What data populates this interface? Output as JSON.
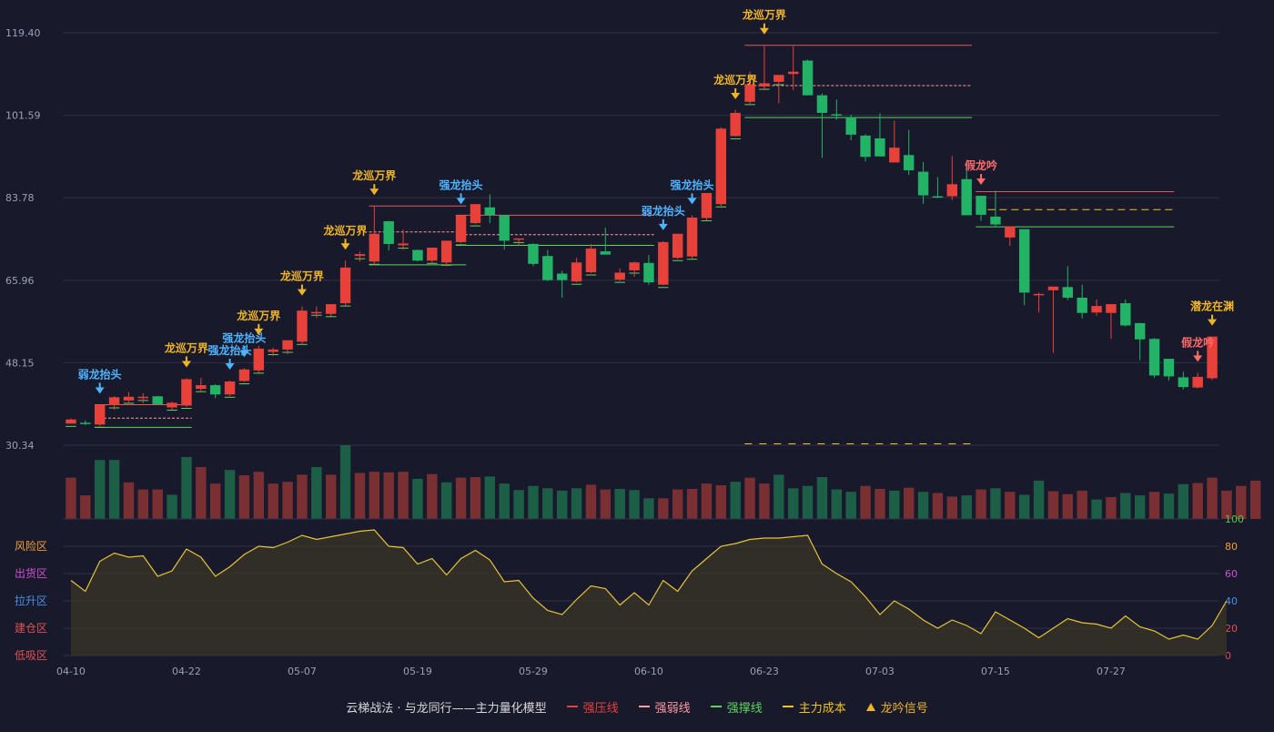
{
  "colors": {
    "up": "#e8413a",
    "down": "#23b366",
    "vol_up": "#7a2f33",
    "vol_down": "#1d5e47",
    "signal_gold": "#f0b429",
    "signal_blue": "#4fb3ff",
    "signal_pink": "#ff6b6b",
    "grid": "#2e3146",
    "axis_text": "#9aa0b4",
    "pressure_line": "#e05a5a",
    "support_line": "#5fd35f",
    "cost_line": "#f0c419",
    "osc_line": "#e8c23a"
  },
  "legend": {
    "title": "云梯战法 · 与龙同行——主力量化模型",
    "items": [
      {
        "label": "强压线",
        "color": "#e8413a",
        "style": "solid"
      },
      {
        "label": "强弱线",
        "color": "#ff9aa2",
        "style": "dashed"
      },
      {
        "label": "强撑线",
        "color": "#5fd35f",
        "style": "solid"
      },
      {
        "label": "主力成本",
        "color": "#f0c419",
        "style": "dashed"
      },
      {
        "label": "龙吟信号",
        "color": "#f0b429",
        "style": "triangle"
      }
    ]
  },
  "chart_data": [
    {
      "type": "candlestick",
      "title": "",
      "y_ticks": [
        "119.40",
        "101.59",
        "83.78",
        "65.96",
        "48.15",
        "30.34"
      ],
      "ylim": [
        30.34,
        119.4
      ],
      "x_tick_labels": [
        {
          "index": 0,
          "label": "04-10"
        },
        {
          "index": 8,
          "label": "04-22"
        },
        {
          "index": 16,
          "label": "05-07"
        },
        {
          "index": 24,
          "label": "05-19"
        },
        {
          "index": 32,
          "label": "05-29"
        },
        {
          "index": 40,
          "label": "06-10"
        },
        {
          "index": 48,
          "label": "06-23"
        },
        {
          "index": 56,
          "label": "07-03"
        },
        {
          "index": 64,
          "label": "07-15"
        },
        {
          "index": 72,
          "label": "07-27"
        }
      ],
      "candles": [
        [
          35.0,
          36.1,
          35.2,
          35.9
        ],
        [
          35.2,
          35.7,
          34.7,
          35.1
        ],
        [
          34.8,
          39.1,
          34.5,
          39.0
        ],
        [
          39.0,
          40.9,
          38.0,
          40.7
        ],
        [
          40.0,
          41.8,
          39.6,
          40.8
        ],
        [
          40.6,
          41.6,
          39.4,
          40.8
        ],
        [
          40.9,
          41.0,
          39.0,
          39.2
        ],
        [
          38.5,
          39.8,
          38.0,
          39.5
        ],
        [
          38.9,
          44.8,
          38.6,
          44.6
        ],
        [
          42.5,
          44.9,
          42.0,
          43.3
        ],
        [
          43.3,
          43.5,
          40.5,
          41.3
        ],
        [
          41.3,
          44.3,
          41.0,
          44.1
        ],
        [
          44.2,
          47.0,
          44.0,
          46.7
        ],
        [
          46.5,
          51.8,
          45.7,
          51.2
        ],
        [
          50.5,
          51.4,
          49.6,
          51.0
        ],
        [
          51.0,
          53.0,
          50.0,
          53.0
        ],
        [
          52.7,
          60.3,
          52.1,
          59.4
        ],
        [
          59.0,
          60.3,
          57.8,
          59.1
        ],
        [
          58.7,
          60.3,
          58.2,
          60.8
        ],
        [
          61.0,
          70.2,
          60.5,
          68.7
        ],
        [
          71.2,
          72.1,
          70.0,
          71.6
        ],
        [
          70.0,
          82.0,
          69.3,
          76.0
        ],
        [
          78.7,
          78.8,
          72.4,
          73.8
        ],
        [
          73.5,
          76.9,
          72.5,
          73.9
        ],
        [
          72.5,
          72.6,
          70.0,
          70.2
        ],
        [
          70.2,
          72.5,
          69.6,
          73.0
        ],
        [
          69.8,
          73.6,
          69.0,
          74.5
        ],
        [
          74.2,
          80.0,
          74.0,
          80.0
        ],
        [
          78.3,
          82.4,
          78.1,
          82.4
        ],
        [
          81.7,
          84.5,
          78.3,
          80.0
        ],
        [
          80.0,
          80.1,
          72.6,
          74.5
        ],
        [
          74.7,
          74.8,
          73.5,
          75.0
        ],
        [
          73.8,
          73.9,
          69.0,
          69.5
        ],
        [
          71.2,
          72.5,
          65.8,
          66.0
        ],
        [
          67.4,
          68.0,
          62.2,
          66.0
        ],
        [
          65.7,
          70.8,
          65.5,
          69.8
        ],
        [
          67.7,
          73.8,
          67.5,
          72.8
        ],
        [
          72.2,
          77.3,
          71.9,
          71.5
        ],
        [
          66.1,
          68.5,
          65.8,
          67.6
        ],
        [
          68.1,
          70.0,
          66.7,
          69.8
        ],
        [
          69.7,
          71.4,
          65.0,
          65.5
        ],
        [
          65.0,
          74.4,
          64.9,
          74.2
        ],
        [
          70.8,
          75.7,
          70.5,
          76.0
        ],
        [
          71.1,
          80.0,
          70.7,
          79.5
        ],
        [
          79.4,
          82.0,
          78.8,
          84.8
        ],
        [
          82.4,
          99.0,
          82.0,
          98.7
        ],
        [
          97.1,
          102.7,
          97.0,
          102.1
        ],
        [
          104.5,
          111.0,
          104.1,
          108.3
        ],
        [
          107.8,
          116.7,
          107.0,
          108.5
        ],
        [
          108.8,
          108.9,
          104.2,
          110.3
        ],
        [
          110.5,
          116.5,
          107.0,
          111.0
        ],
        [
          113.4,
          113.6,
          105.9,
          105.9
        ],
        [
          105.9,
          106.3,
          92.4,
          102.1
        ],
        [
          101.8,
          105.0,
          100.6,
          101.7
        ],
        [
          101.2,
          101.7,
          96.2,
          97.4
        ],
        [
          97.2,
          97.5,
          91.6,
          92.6
        ],
        [
          96.6,
          102.0,
          92.7,
          92.7
        ],
        [
          91.4,
          100.4,
          91.7,
          94.6
        ],
        [
          93.0,
          98.4,
          88.7,
          89.7
        ],
        [
          89.4,
          91.5,
          82.5,
          84.3
        ],
        [
          84.1,
          88.2,
          83.7,
          84.0
        ],
        [
          84.1,
          92.8,
          83.3,
          86.7
        ],
        [
          87.8,
          89.6,
          86.0,
          80.0
        ],
        [
          84.2,
          84.0,
          78.8,
          80.1
        ],
        [
          79.7,
          85.3,
          77.5,
          78.0
        ],
        [
          75.2,
          75.5,
          73.4,
          77.6
        ],
        [
          77.0,
          77.0,
          60.6,
          63.3
        ],
        [
          62.8,
          63.3,
          59.0,
          63.0
        ],
        [
          63.8,
          64.1,
          50.3,
          64.6
        ],
        [
          64.5,
          69.0,
          61.7,
          62.2
        ],
        [
          62.2,
          65.0,
          57.7,
          58.9
        ],
        [
          59.0,
          61.8,
          58.3,
          60.4
        ],
        [
          58.9,
          60.0,
          53.3,
          60.8
        ],
        [
          61.0,
          61.8,
          56.0,
          56.2
        ],
        [
          56.7,
          56.8,
          48.7,
          53.2
        ],
        [
          53.3,
          53.5,
          44.9,
          45.4
        ],
        [
          49.0,
          48.9,
          44.3,
          45.2
        ],
        [
          45.0,
          46.2,
          42.4,
          42.9
        ],
        [
          42.8,
          46.0,
          42.6,
          45.1
        ],
        [
          44.8,
          46.8,
          44.4,
          53.8
        ]
      ],
      "volume": [
        70,
        40,
        100,
        100,
        62,
        50,
        50,
        41,
        105,
        88,
        60,
        83,
        74,
        80,
        60,
        63,
        75,
        88,
        75,
        125,
        78,
        80,
        79,
        80,
        68,
        76,
        62,
        70,
        71,
        72,
        60,
        49,
        56,
        52,
        48,
        52,
        58,
        50,
        51,
        49,
        35,
        35,
        50,
        51,
        60,
        57,
        63,
        70,
        60,
        75,
        52,
        56,
        71,
        50,
        46,
        56,
        51,
        48,
        53,
        46,
        44,
        38,
        40,
        50,
        52,
        46,
        41,
        65,
        47,
        42,
        48,
        33,
        37,
        44,
        40,
        46,
        43,
        59,
        61,
        70,
        48,
        56,
        65
      ],
      "vol_up": [
        true,
        true,
        false,
        false,
        true,
        true,
        true,
        false,
        false,
        true,
        true,
        false,
        true,
        true,
        true,
        true,
        true,
        false,
        true,
        false,
        true,
        true,
        true,
        true,
        false,
        true,
        false,
        true,
        true,
        false,
        false,
        false,
        false,
        false,
        false,
        false,
        true,
        true,
        false,
        false,
        false,
        true,
        true,
        true,
        true,
        true,
        false,
        true,
        true,
        false,
        false,
        false,
        false,
        false,
        false,
        true,
        true,
        false,
        true,
        false,
        true,
        true,
        false,
        true,
        false,
        true,
        false,
        false,
        true,
        true,
        true,
        false,
        true,
        false,
        false,
        true,
        false,
        false,
        true,
        true,
        true,
        true,
        true
      ]
    },
    {
      "type": "line",
      "title": "",
      "ylim": [
        0,
        100
      ],
      "right_ticks": [
        "100",
        "80",
        "60",
        "40",
        "20",
        "0"
      ],
      "zones": [
        "风险区",
        "出货区",
        "拉升区",
        "建仓区",
        "低吸区"
      ],
      "values": [
        55,
        47,
        69,
        75,
        72,
        73,
        58,
        62,
        78,
        72,
        58,
        65,
        74,
        80,
        79,
        83,
        88,
        85,
        87,
        89,
        91,
        92,
        80,
        79,
        67,
        71,
        59,
        71,
        77,
        70,
        54,
        55,
        42,
        33,
        30,
        41,
        51,
        49,
        37,
        46,
        37,
        55,
        47,
        62,
        71,
        80,
        82,
        85,
        86,
        86,
        87,
        88,
        67,
        60,
        54,
        43,
        30,
        40,
        34,
        26,
        20,
        26,
        22,
        16,
        32,
        26,
        20,
        13,
        20,
        27,
        24,
        23,
        20,
        29,
        21,
        18,
        12,
        15,
        12,
        22,
        40
      ]
    }
  ],
  "signals": [
    {
      "index": 2,
      "label": "弱龙抬头",
      "kind": "blue"
    },
    {
      "index": 8,
      "label": "龙巡万界",
      "kind": "gold"
    },
    {
      "index": 11,
      "label": "强龙抬头",
      "kind": "blue"
    },
    {
      "index": 12,
      "label": "强龙抬头",
      "kind": "blue"
    },
    {
      "index": 13,
      "label": "龙巡万界",
      "kind": "gold"
    },
    {
      "index": 16,
      "label": "龙巡万界",
      "kind": "gold"
    },
    {
      "index": 19,
      "label": "龙巡万界",
      "kind": "gold"
    },
    {
      "index": 21,
      "label": "龙巡万界",
      "kind": "gold"
    },
    {
      "index": 27,
      "label": "强龙抬头",
      "kind": "blue"
    },
    {
      "index": 41,
      "label": "弱龙抬头",
      "kind": "blue"
    },
    {
      "index": 43,
      "label": "强龙抬头",
      "kind": "blue"
    },
    {
      "index": 46,
      "label": "龙巡万界",
      "kind": "gold"
    },
    {
      "index": 48,
      "label": "龙巡万界",
      "kind": "gold"
    },
    {
      "index": 63,
      "label": "假龙吟",
      "kind": "pink"
    },
    {
      "index": 78,
      "label": "假龙吟",
      "kind": "pink"
    },
    {
      "index": 79,
      "label": "潜龙在渊",
      "kind": "gold"
    }
  ]
}
